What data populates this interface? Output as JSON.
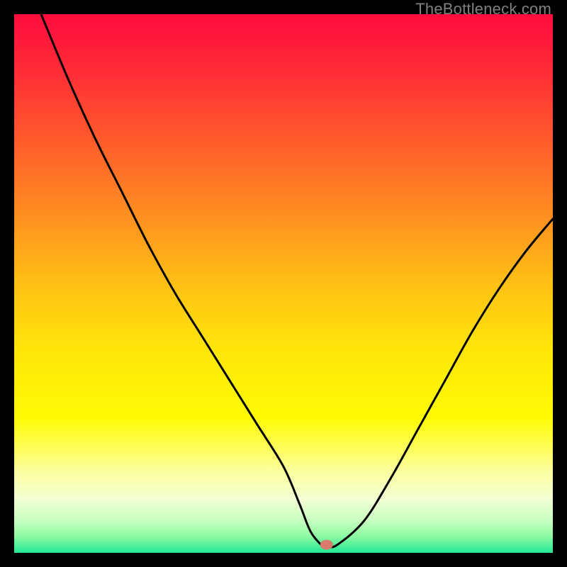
{
  "watermark": "TheBottleneck.com",
  "chart_data": {
    "type": "line",
    "title": "",
    "xlabel": "",
    "ylabel": "",
    "xlim": [
      0,
      100
    ],
    "ylim": [
      0,
      100
    ],
    "grid": false,
    "legend": false,
    "background_gradient": {
      "stops": [
        {
          "offset": 0.0,
          "color": "#ff0b3e"
        },
        {
          "offset": 0.1,
          "color": "#ff2a37"
        },
        {
          "offset": 0.23,
          "color": "#ff5a2c"
        },
        {
          "offset": 0.36,
          "color": "#ff8a22"
        },
        {
          "offset": 0.5,
          "color": "#ffc015"
        },
        {
          "offset": 0.62,
          "color": "#ffe50a"
        },
        {
          "offset": 0.75,
          "color": "#fffb05"
        },
        {
          "offset": 0.85,
          "color": "#fcffa0"
        },
        {
          "offset": 0.9,
          "color": "#f2ffd3"
        },
        {
          "offset": 0.94,
          "color": "#c8ffbf"
        },
        {
          "offset": 0.97,
          "color": "#8cf9a3"
        },
        {
          "offset": 1.0,
          "color": "#22e793"
        }
      ]
    },
    "series": [
      {
        "name": "bottleneck-curve",
        "x": [
          5,
          10,
          15,
          20,
          25,
          30,
          35,
          40,
          45,
          50,
          53,
          55,
          57,
          58,
          60,
          65,
          70,
          75,
          80,
          85,
          90,
          95,
          100
        ],
        "y": [
          100,
          88,
          77,
          67,
          57,
          48,
          40,
          32,
          24,
          16,
          9,
          4,
          1.5,
          1.2,
          1.5,
          6,
          14,
          23,
          32,
          41,
          49,
          56,
          62
        ]
      }
    ],
    "marker": {
      "x": 58,
      "y": 1.5,
      "color": "#d97a6a",
      "rx": 9,
      "ry": 7
    }
  }
}
